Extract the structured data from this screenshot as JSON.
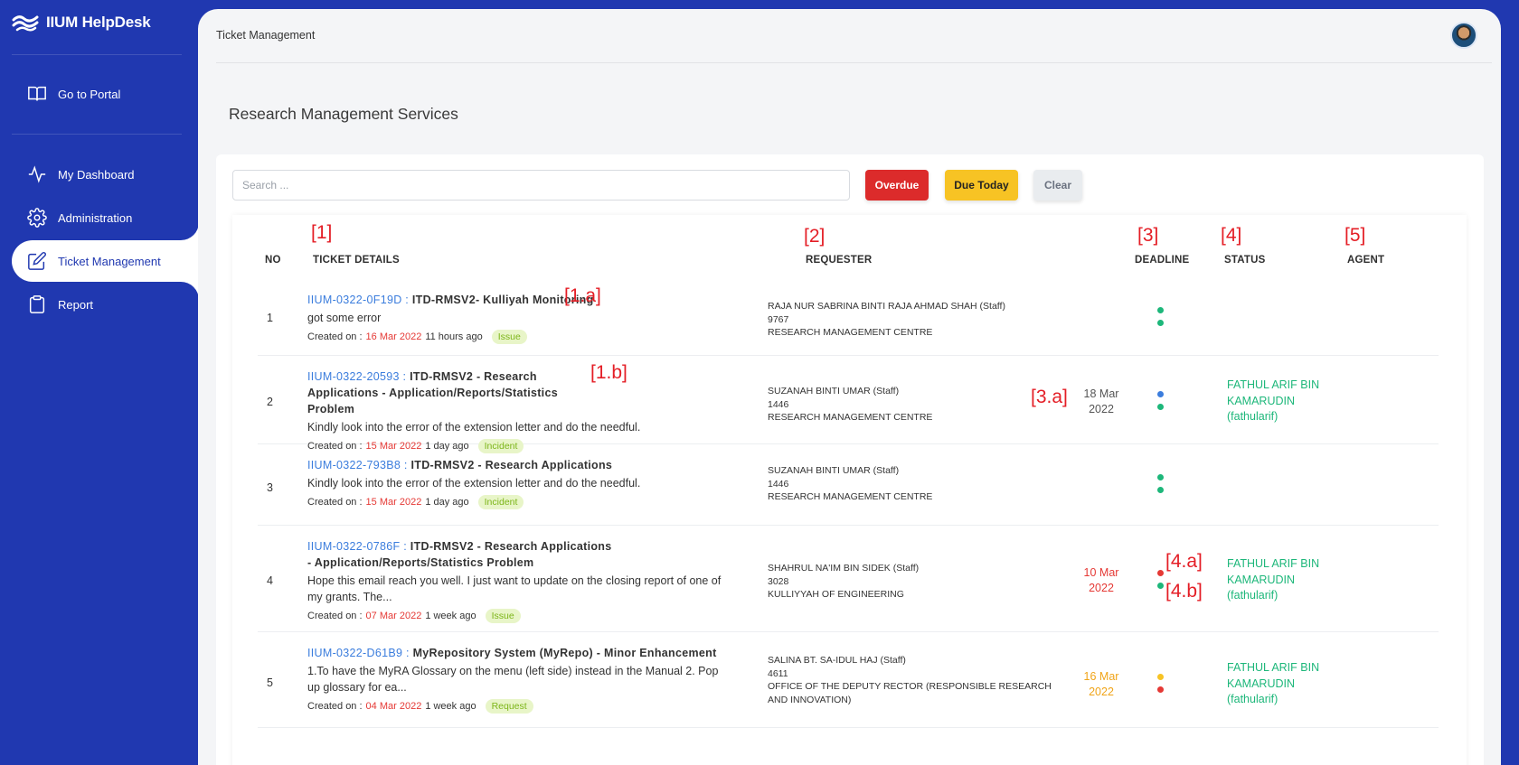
{
  "app": {
    "name": "IIUM HelpDesk"
  },
  "sidebar": {
    "items": [
      {
        "label": "Go to Portal",
        "icon": "book-icon"
      },
      {
        "label": "My Dashboard",
        "icon": "activity-icon"
      },
      {
        "label": "Administration",
        "icon": "gear-icon"
      },
      {
        "label": "Ticket Management",
        "icon": "edit-icon",
        "active": true
      },
      {
        "label": "Report",
        "icon": "clipboard-icon"
      }
    ]
  },
  "header": {
    "breadcrumb": "Ticket Management"
  },
  "page": {
    "title": "Research Management Services"
  },
  "search": {
    "placeholder": "Search ...",
    "value": ""
  },
  "filters": {
    "overdue": "Overdue",
    "due_today": "Due Today",
    "clear": "Clear"
  },
  "table": {
    "columns": {
      "no": "NO",
      "details": "TICKET DETAILS",
      "requester": "REQUESTER",
      "deadline": "DEADLINE",
      "status": "STATUS",
      "agent": "AGENT"
    },
    "rows": [
      {
        "no": "1",
        "id": "IIUM-0322-0F19D :",
        "title": "ITD-RMSV2- Kulliyah Monitoring",
        "description": "got some error",
        "created_label": "Created on :",
        "created_date": "16 Mar 2022",
        "created_ago": "11 hours ago",
        "type": "Issue",
        "requester_name": "RAJA NUR SABRINA BINTI RAJA AHMAD SHAH (Staff)",
        "requester_ext": "9767",
        "requester_dept": "RESEARCH MANAGEMENT CENTRE",
        "deadline_day": "",
        "deadline_year": "",
        "status_dots": [
          "green",
          "green"
        ],
        "agent_name": "",
        "agent_line2": "",
        "agent_user": ""
      },
      {
        "no": "2",
        "id": "IIUM-0322-20593 :",
        "title": "ITD-RMSV2 - Research Applications - Application/Reports/Statistics Problem",
        "description": "Kindly look into the error of the extension letter and do the needful.",
        "created_label": "Created on :",
        "created_date": "15 Mar 2022",
        "created_ago": "1 day ago",
        "type": "Incident",
        "requester_name": "SUZANAH BINTI UMAR (Staff)",
        "requester_ext": "1446",
        "requester_dept": "RESEARCH MANAGEMENT CENTRE",
        "deadline_day": "18 Mar",
        "deadline_year": "2022",
        "status_dots": [
          "blue",
          "green"
        ],
        "agent_name": "FATHUL ARIF BIN",
        "agent_line2": "KAMARUDIN",
        "agent_user": "(fathularif)"
      },
      {
        "no": "3",
        "id": "IIUM-0322-793B8 :",
        "title": "ITD-RMSV2 - Research Applications",
        "description": "Kindly look into the error of the extension letter and do the needful.",
        "created_label": "Created on :",
        "created_date": "15 Mar 2022",
        "created_ago": "1 day ago",
        "type": "Incident",
        "requester_name": "SUZANAH BINTI UMAR (Staff)",
        "requester_ext": "1446",
        "requester_dept": "RESEARCH MANAGEMENT CENTRE",
        "deadline_day": "",
        "deadline_year": "",
        "status_dots": [
          "green",
          "green"
        ],
        "agent_name": "",
        "agent_line2": "",
        "agent_user": ""
      },
      {
        "no": "4",
        "id": "IIUM-0322-0786F :",
        "title": "ITD-RMSV2 - Research Applications - Application/Reports/Statistics Problem",
        "description": "Hope this email reach you well. I just want to update on the closing report of one of my grants. The...",
        "created_label": "Created on :",
        "created_date": "07 Mar 2022",
        "created_ago": "1 week ago",
        "type": "Issue",
        "requester_name": "SHAHRUL NA'IM BIN SIDEK (Staff)",
        "requester_ext": "3028",
        "requester_dept": "KULLIYYAH OF ENGINEERING",
        "deadline_day": "10 Mar",
        "deadline_year": "2022",
        "status_dots": [
          "red",
          "green"
        ],
        "agent_name": "FATHUL ARIF BIN",
        "agent_line2": "KAMARUDIN",
        "agent_user": "(fathularif)"
      },
      {
        "no": "5",
        "id": "IIUM-0322-D61B9 :",
        "title": "MyRepository System (MyRepo) - Minor Enhancement",
        "description": "1.To have the MyRA Glossary on the menu (left side) instead in the Manual 2. Pop up glossary for ea...",
        "created_label": "Created on :",
        "created_date": "04 Mar 2022",
        "created_ago": "1 week ago",
        "type": "Request",
        "requester_name": "SALINA BT. SA-IDUL HAJ (Staff)",
        "requester_ext": "4611",
        "requester_dept": "OFFICE OF THE DEPUTY RECTOR (RESPONSIBLE RESEARCH AND INNOVATION)",
        "deadline_day": "16 Mar",
        "deadline_year": "2022",
        "status_dots": [
          "yellow",
          "red"
        ],
        "agent_name": "FATHUL ARIF BIN",
        "agent_line2": "KAMARUDIN",
        "agent_user": "(fathularif)"
      }
    ]
  },
  "annotations": {
    "a1": "[1]",
    "a2": "[2]",
    "a3": "[3]",
    "a4": "[4]",
    "a5": "[5]",
    "a1a": "[1.a]",
    "a1b": "[1.b]",
    "a3a": "[3.a]",
    "a4a": "[4.a]",
    "a4b": "[4.b]"
  },
  "colors": {
    "sidebar": "#2038b0",
    "link": "#3b7ddd",
    "danger": "#dc2b2b",
    "warning": "#f7c324",
    "success": "#1db77a"
  }
}
